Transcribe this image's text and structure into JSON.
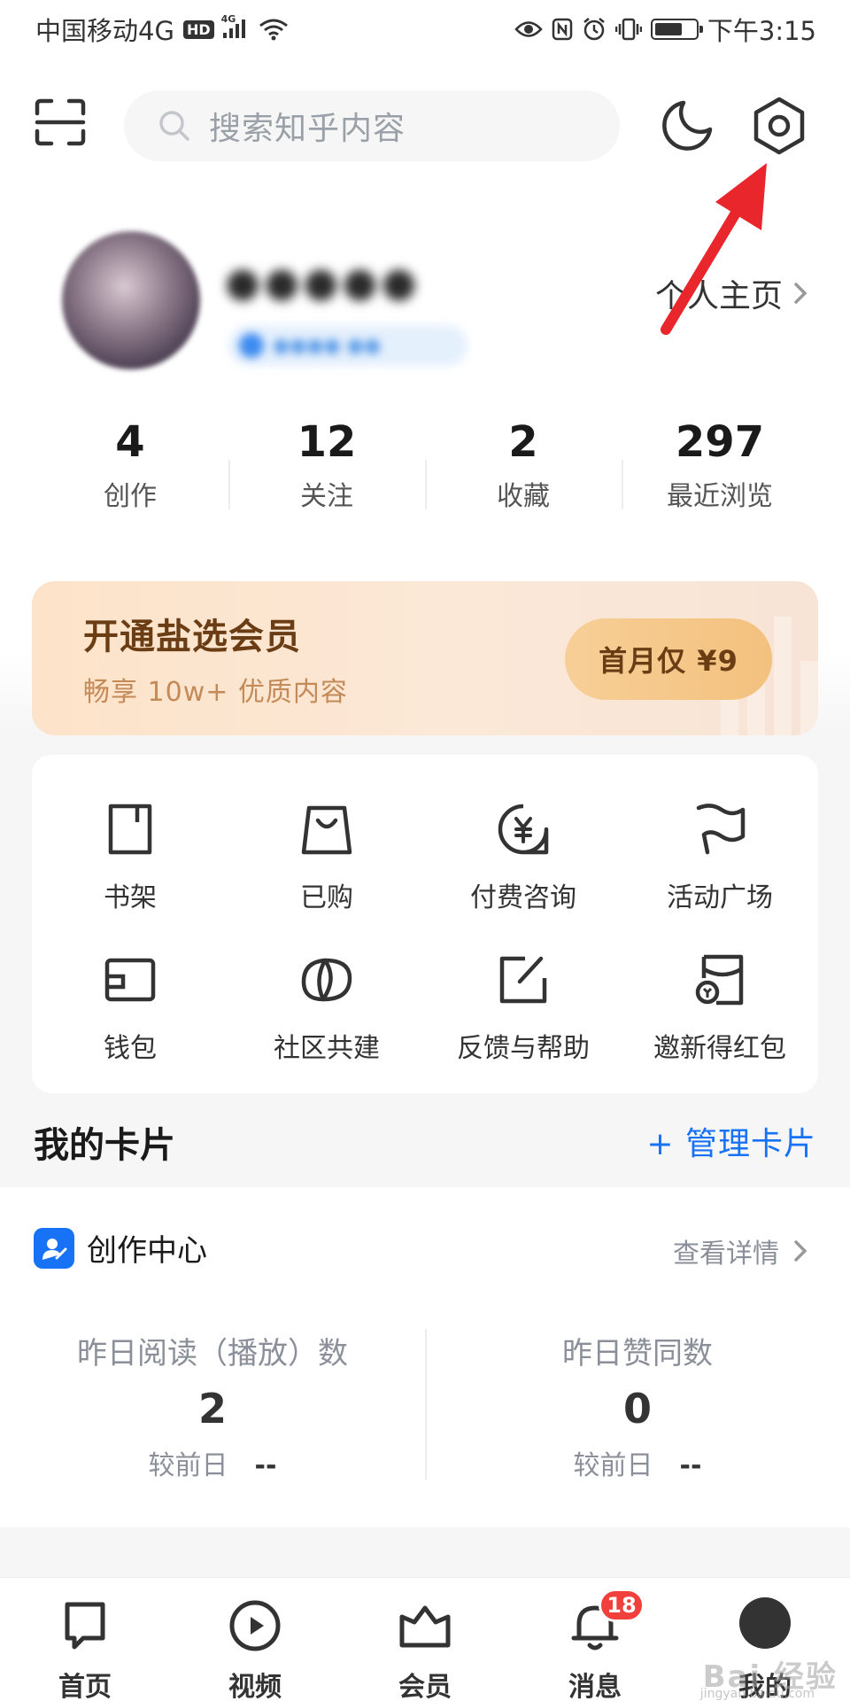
{
  "status_bar": {
    "carrier": "中国移动4G",
    "hd": "HD",
    "net": "4G",
    "time": "下午3:15"
  },
  "search": {
    "placeholder": "搜索知乎内容"
  },
  "profile": {
    "homepage_link": "个人主页"
  },
  "stats": [
    {
      "value": "4",
      "label": "创作"
    },
    {
      "value": "12",
      "label": "关注"
    },
    {
      "value": "2",
      "label": "收藏"
    },
    {
      "value": "297",
      "label": "最近浏览"
    }
  ],
  "vip": {
    "title": "开通盐选会员",
    "subtitle": "畅享 10w+ 优质内容",
    "button": "首月仅 ¥9"
  },
  "tools": [
    {
      "label": "书架",
      "icon": "bookshelf-icon"
    },
    {
      "label": "已购",
      "icon": "shopping-bag-icon"
    },
    {
      "label": "付费咨询",
      "icon": "paid-consult-icon"
    },
    {
      "label": "活动广场",
      "icon": "flag-icon"
    },
    {
      "label": "钱包",
      "icon": "wallet-icon"
    },
    {
      "label": "社区共建",
      "icon": "community-icon"
    },
    {
      "label": "反馈与帮助",
      "icon": "feedback-icon"
    },
    {
      "label": "邀新得红包",
      "icon": "red-packet-icon"
    }
  ],
  "cards": {
    "title": "我的卡片",
    "manage": "+ 管理卡片"
  },
  "creator": {
    "title": "创作中心",
    "detail": "查看详情",
    "stats": [
      {
        "label": "昨日阅读（播放）数",
        "value": "2",
        "compare_label": "较前日",
        "compare_value": "--"
      },
      {
        "label": "昨日赞同数",
        "value": "0",
        "compare_label": "较前日",
        "compare_value": "--"
      }
    ]
  },
  "tab_bar": [
    {
      "label": "首页",
      "icon": "home-icon"
    },
    {
      "label": "视频",
      "icon": "video-play-icon"
    },
    {
      "label": "会员",
      "icon": "crown-icon"
    },
    {
      "label": "消息",
      "icon": "bell-icon",
      "badge": "18"
    },
    {
      "label": "我的",
      "icon": "avatar"
    }
  ],
  "watermark": {
    "text": "Bai 经验",
    "sub": "jingyan.baidu.com"
  },
  "colors": {
    "accent": "#1772f6",
    "badge_red": "#f1403c",
    "vip_gold": "#6b3d14",
    "arrow_red": "#e8262c"
  }
}
